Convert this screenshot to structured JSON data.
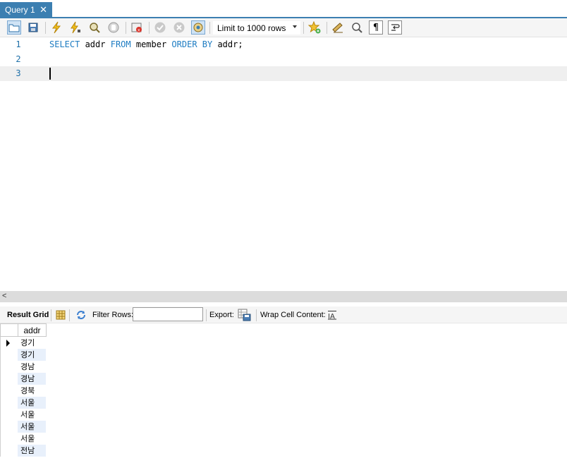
{
  "tab": {
    "title": "Query 1",
    "close": "✕"
  },
  "toolbar": {
    "limit_label": "Limit to 1000 rows"
  },
  "editor": {
    "lines": [
      {
        "number": "1",
        "kw1": "SELECT",
        "t1": " addr ",
        "kw2": "FROM",
        "t2": " member ",
        "kw3": "ORDER BY",
        "t3": " addr;"
      },
      {
        "number": "2"
      },
      {
        "number": "3"
      }
    ]
  },
  "results": {
    "result_grid_label": "Result Grid",
    "filter_label": "Filter Rows:",
    "filter_value": "",
    "export_label": "Export:",
    "wrap_label": "Wrap Cell Content:",
    "column": "addr",
    "rows": [
      "경기",
      "경기",
      "경남",
      "경남",
      "경북",
      "서울",
      "서울",
      "서울",
      "서울",
      "전남"
    ]
  }
}
